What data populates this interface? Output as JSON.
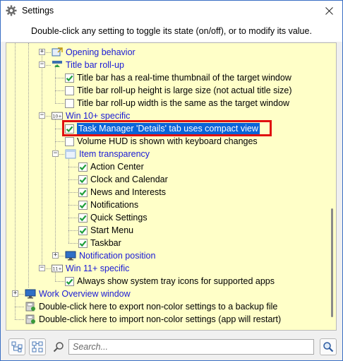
{
  "window": {
    "title": "Settings",
    "icon": "gear-icon",
    "close_icon": "close-icon"
  },
  "instructions": "Double-click any setting to toggle its state (on/off), or to modify its value.",
  "tree": [
    {
      "label": "Opening behavior",
      "type": "node",
      "link": true,
      "expander": "+"
    },
    {
      "label": "Title bar roll-up",
      "type": "node",
      "link": true,
      "expander": "-"
    },
    {
      "label": "Title bar has a real-time thumbnail of the target window",
      "type": "checkbox",
      "checked": true
    },
    {
      "label": "Title bar roll-up height is large size (not actual title size)",
      "type": "checkbox",
      "checked": false
    },
    {
      "label": "Title bar roll-up width is the same as the target window",
      "type": "checkbox",
      "checked": false
    },
    {
      "label": "Win 10+ specific",
      "type": "node",
      "link": true,
      "expander": "-",
      "badge": "10+"
    },
    {
      "label": "Task Manager 'Details' tab uses compact view",
      "type": "checkbox",
      "checked": true,
      "selected": true
    },
    {
      "label": "Volume HUD is shown with keyboard changes",
      "type": "checkbox",
      "checked": false
    },
    {
      "label": "Item transparency",
      "type": "node",
      "link": true,
      "expander": "-"
    },
    {
      "label": "Action Center",
      "type": "checkbox",
      "checked": true
    },
    {
      "label": "Clock and Calendar",
      "type": "checkbox",
      "checked": true
    },
    {
      "label": "News and Interests",
      "type": "checkbox",
      "checked": true
    },
    {
      "label": "Notifications",
      "type": "checkbox",
      "checked": true
    },
    {
      "label": "Quick Settings",
      "type": "checkbox",
      "checked": true
    },
    {
      "label": "Start Menu",
      "type": "checkbox",
      "checked": true
    },
    {
      "label": "Taskbar",
      "type": "checkbox",
      "checked": true
    },
    {
      "label": "Notification position",
      "type": "node",
      "link": true,
      "expander": "+"
    },
    {
      "label": "Win 11+ specific",
      "type": "node",
      "link": true,
      "expander": "-",
      "badge": "11+"
    },
    {
      "label": "Always show system tray icons for supported apps",
      "type": "checkbox",
      "checked": true
    },
    {
      "label": "Work Overview window",
      "type": "node",
      "link": true,
      "expander": "+"
    },
    {
      "label": "Double-click here to export non-color settings to a backup file",
      "type": "action"
    },
    {
      "label": "Double-click here to import non-color settings (app will restart)",
      "type": "action"
    }
  ],
  "search": {
    "placeholder": "Search..."
  },
  "colors": {
    "tree_bg": "#ffffc8",
    "link": "#1a1ad6",
    "selection": "#0a64d8",
    "highlight_border": "#e01010",
    "check": "#1f9e3b"
  }
}
